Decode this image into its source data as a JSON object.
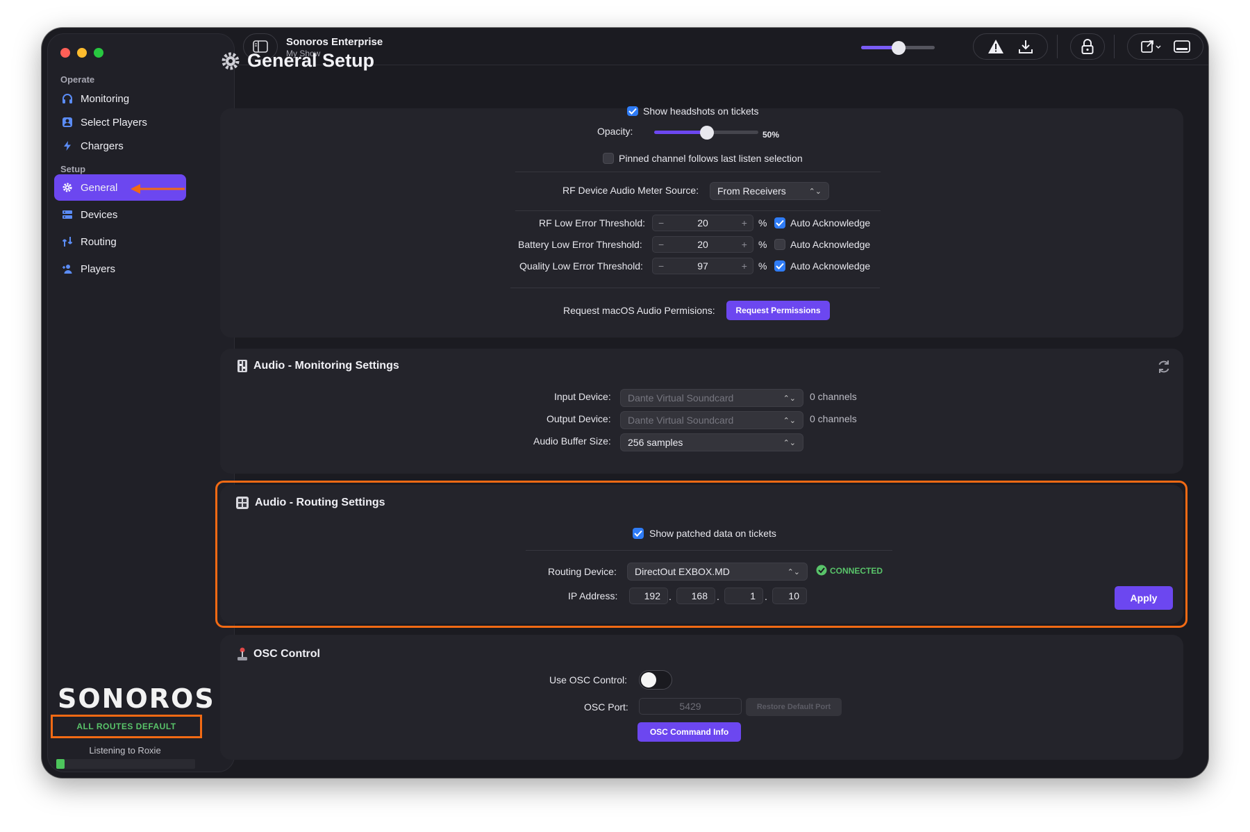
{
  "window": {
    "app_title": "Sonoros Enterprise",
    "app_subtitle": "My Show"
  },
  "sidebar": {
    "sections": [
      {
        "label": "Operate"
      },
      {
        "label": "Setup"
      }
    ],
    "items": [
      {
        "label": "Monitoring",
        "icon": "headphones-icon"
      },
      {
        "label": "Select Players",
        "icon": "player-badge-icon"
      },
      {
        "label": "Chargers",
        "icon": "bolt-icon"
      },
      {
        "label": "General",
        "icon": "gear-icon",
        "active": true
      },
      {
        "label": "Devices",
        "icon": "devices-icon"
      },
      {
        "label": "Routing",
        "icon": "routing-icon"
      },
      {
        "label": "Players",
        "icon": "players-icon"
      }
    ],
    "logo": "SONOROS",
    "routes_status": "ALL ROUTES DEFAULT",
    "listening": "Listening to Roxie",
    "meter_level": 0.06
  },
  "page": {
    "title": "General Setup"
  },
  "general": {
    "show_headshots": {
      "label": "Show headshots on tickets",
      "checked": true
    },
    "opacity": {
      "label": "Opacity:",
      "value": "50%",
      "fraction": 0.5
    },
    "pinned_channel": {
      "label": "Pinned channel follows last listen selection",
      "checked": false
    },
    "rf_meter_source": {
      "label": "RF Device Audio Meter Source:",
      "value": "From Receivers"
    },
    "thresholds": [
      {
        "label": "RF Low Error Threshold:",
        "value": "20",
        "unit": "%",
        "auto_label": "Auto Acknowledge",
        "auto": true
      },
      {
        "label": "Battery Low Error Threshold:",
        "value": "20",
        "unit": "%",
        "auto_label": "Auto Acknowledge",
        "auto": false
      },
      {
        "label": "Quality Low Error Threshold:",
        "value": "97",
        "unit": "%",
        "auto_label": "Auto Acknowledge",
        "auto": true
      }
    ],
    "permissions": {
      "label": "Request macOS Audio Permisions:",
      "button": "Request Permissions"
    }
  },
  "monitoring": {
    "title": "Audio - Monitoring Settings",
    "input_device": {
      "label": "Input Device:",
      "value": "Dante Virtual Soundcard",
      "channels": "0 channels"
    },
    "output_device": {
      "label": "Output Device:",
      "value": "Dante Virtual Soundcard",
      "channels": "0 channels"
    },
    "buffer": {
      "label": "Audio Buffer Size:",
      "value": "256 samples"
    }
  },
  "routing": {
    "title": "Audio - Routing Settings",
    "show_patched": {
      "label": "Show patched data on tickets",
      "checked": true
    },
    "device": {
      "label": "Routing Device:",
      "value": "DirectOut EXBOX.MD",
      "status": "CONNECTED"
    },
    "ip": {
      "label": "IP Address:",
      "octets": [
        "192",
        "168",
        "1",
        "10"
      ],
      "separator": "."
    },
    "apply": "Apply"
  },
  "osc": {
    "title": "OSC Control",
    "use": {
      "label": "Use OSC Control:",
      "on": false
    },
    "port": {
      "label": "OSC Port:",
      "value": "5429",
      "restore": "Restore Default Port"
    },
    "info_button": "OSC Command Info"
  },
  "colors": {
    "accent": "#6c47f0",
    "highlight": "#f26a14",
    "connected": "#59c46a",
    "checkbox": "#2f7cf6"
  }
}
